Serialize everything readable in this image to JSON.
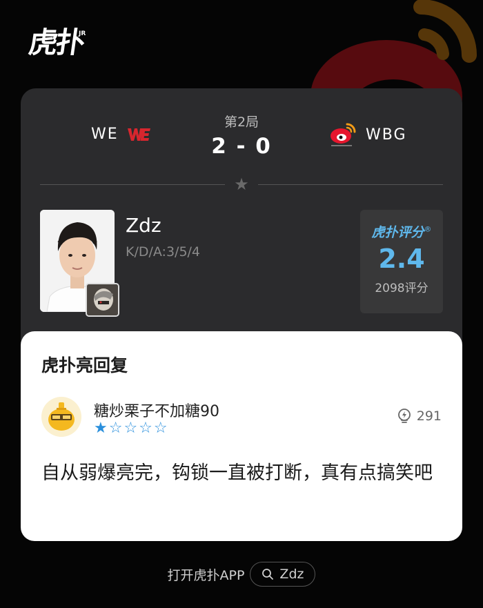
{
  "brand": {
    "logo_text": "虎扑",
    "logo_sup": "JR"
  },
  "match": {
    "round": "第2局",
    "score": "2 - 0",
    "team_left": {
      "name": "WE",
      "logo_text": "WE"
    },
    "team_right": {
      "name": "WBG"
    }
  },
  "player": {
    "name": "Zdz",
    "kda": "K/D/A:3/5/4"
  },
  "rating": {
    "logo_text": "虎扑评分",
    "logo_sup": "®",
    "value": "2.4",
    "count": "2098评分"
  },
  "reply": {
    "title": "虎扑亮回复",
    "username": "糖炒栗子不加糖90",
    "stars": "★☆☆☆☆",
    "star_rating": 1,
    "likes": "291",
    "comment": "自从弱爆亮完，钩锁一直被打断，真有点搞笑吧"
  },
  "footer": {
    "text": "打开虎扑APP",
    "search_label": "Zdz"
  },
  "colors": {
    "accent_blue": "#5fb8ec",
    "star_blue": "#2a8fdc",
    "we_red": "#d7262e",
    "weibo_red": "#e6162d",
    "weibo_orange": "#f39b17"
  },
  "icons": [
    "weibo-logo-icon",
    "we-logo-icon",
    "star-icon",
    "lightbulb-icon",
    "search-icon"
  ]
}
